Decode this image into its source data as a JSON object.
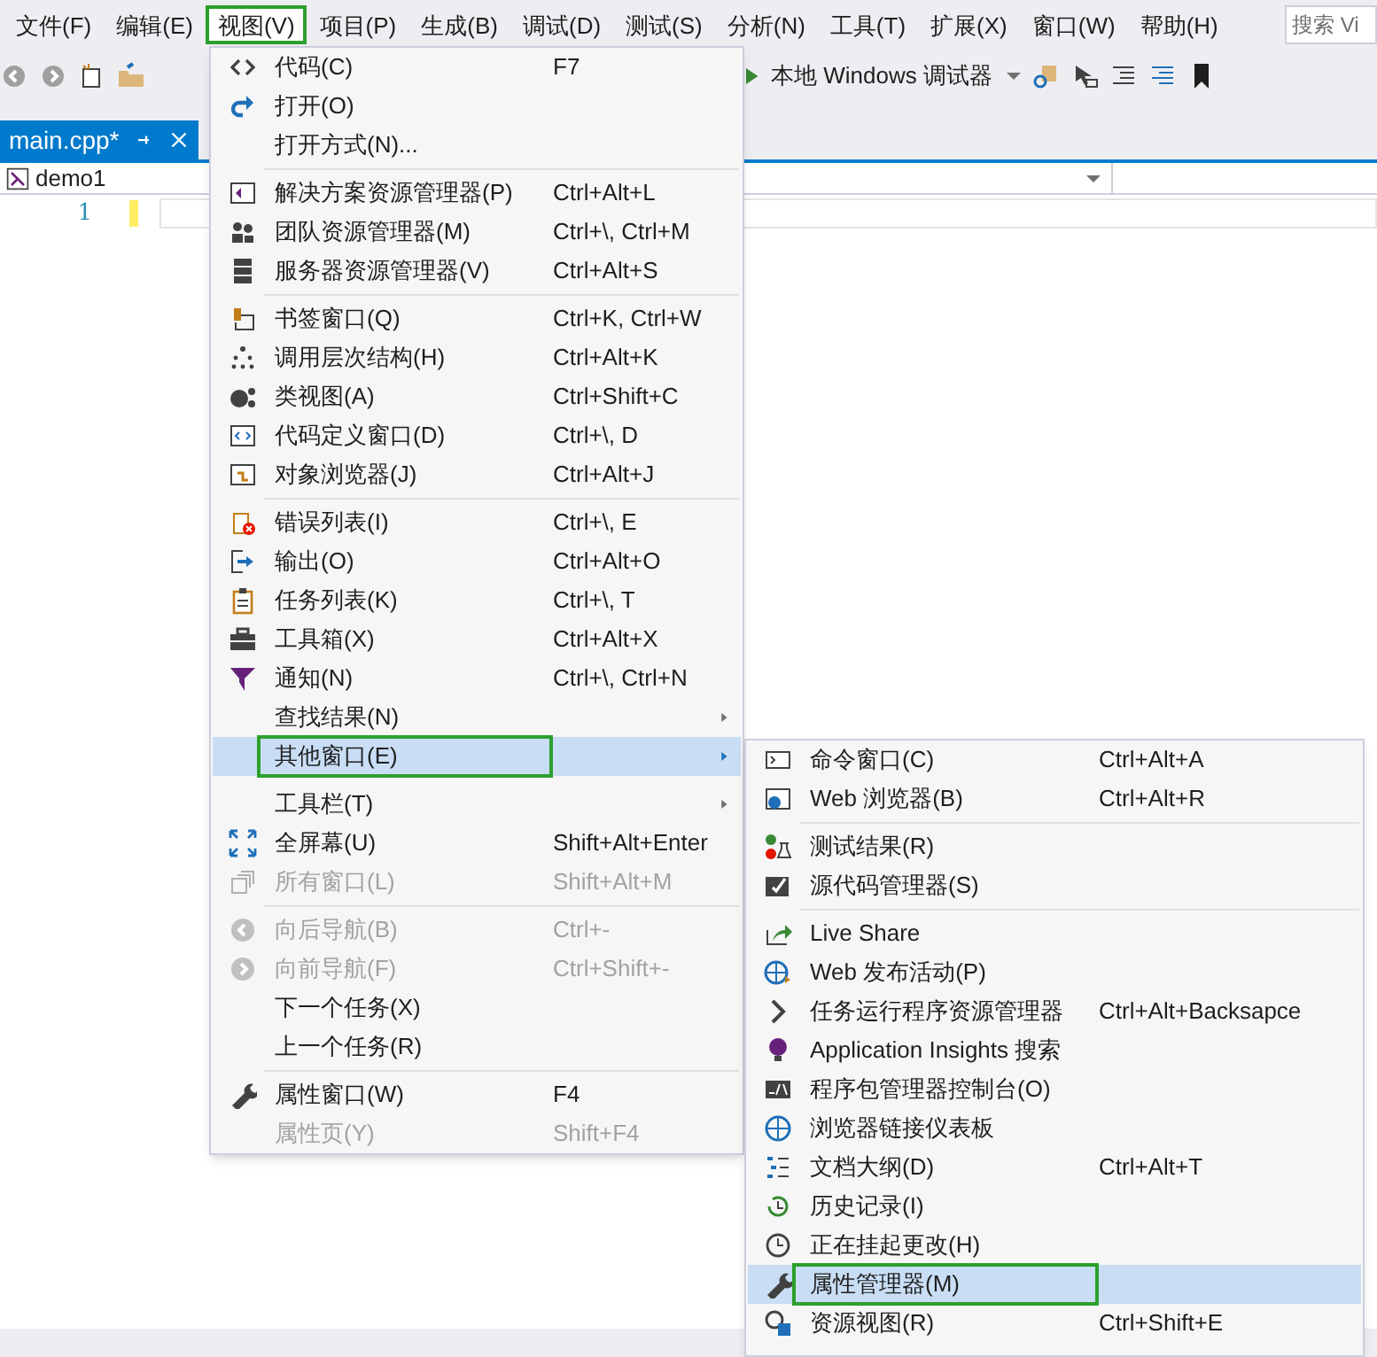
{
  "menubar": {
    "items": [
      {
        "label": "文件(F)",
        "outlined": false
      },
      {
        "label": "编辑(E)",
        "outlined": false
      },
      {
        "label": "视图(V)",
        "outlined": true
      },
      {
        "label": "项目(P)",
        "outlined": false
      },
      {
        "label": "生成(B)",
        "outlined": false
      },
      {
        "label": "调试(D)",
        "outlined": false
      },
      {
        "label": "测试(S)",
        "outlined": false
      },
      {
        "label": "分析(N)",
        "outlined": false
      },
      {
        "label": "工具(T)",
        "outlined": false
      },
      {
        "label": "扩展(X)",
        "outlined": false
      },
      {
        "label": "窗口(W)",
        "outlined": false
      },
      {
        "label": "帮助(H)",
        "outlined": false
      }
    ],
    "search": {
      "placeholder": "搜索 Vi"
    }
  },
  "toolbar": {
    "debug_button": "本地 Windows 调试器"
  },
  "tab": {
    "label": "main.cpp*",
    "selected": true
  },
  "nav_bar": {
    "scope": "demo1"
  },
  "editor": {
    "line_numbers": [
      "1"
    ]
  },
  "view_menu": [
    {
      "kind": "item",
      "label": "代码(C)",
      "shortcut": "F7",
      "disabled": false,
      "selected": false,
      "outlined": false,
      "submenu": false
    },
    {
      "kind": "item",
      "label": "打开(O)",
      "disabled": false,
      "selected": false,
      "outlined": false,
      "submenu": false
    },
    {
      "kind": "item",
      "label": "打开方式(N)...",
      "disabled": false,
      "selected": false,
      "outlined": false,
      "submenu": false
    },
    {
      "kind": "separator"
    },
    {
      "kind": "item",
      "label": "解决方案资源管理器(P)",
      "shortcut": "Ctrl+Alt+L",
      "disabled": false,
      "selected": false,
      "outlined": false,
      "submenu": false
    },
    {
      "kind": "item",
      "label": "团队资源管理器(M)",
      "shortcut": "Ctrl+\\, Ctrl+M",
      "disabled": false,
      "selected": false,
      "outlined": false,
      "submenu": false
    },
    {
      "kind": "item",
      "label": "服务器资源管理器(V)",
      "shortcut": "Ctrl+Alt+S",
      "disabled": false,
      "selected": false,
      "outlined": false,
      "submenu": false
    },
    {
      "kind": "separator"
    },
    {
      "kind": "item",
      "label": "书签窗口(Q)",
      "shortcut": "Ctrl+K, Ctrl+W",
      "disabled": false,
      "selected": false,
      "outlined": false,
      "submenu": false
    },
    {
      "kind": "item",
      "label": "调用层次结构(H)",
      "shortcut": "Ctrl+Alt+K",
      "disabled": false,
      "selected": false,
      "outlined": false,
      "submenu": false
    },
    {
      "kind": "item",
      "label": "类视图(A)",
      "shortcut": "Ctrl+Shift+C",
      "disabled": false,
      "selected": false,
      "outlined": false,
      "submenu": false
    },
    {
      "kind": "item",
      "label": "代码定义窗口(D)",
      "shortcut": "Ctrl+\\, D",
      "disabled": false,
      "selected": false,
      "outlined": false,
      "submenu": false
    },
    {
      "kind": "item",
      "label": "对象浏览器(J)",
      "shortcut": "Ctrl+Alt+J",
      "disabled": false,
      "selected": false,
      "outlined": false,
      "submenu": false
    },
    {
      "kind": "separator"
    },
    {
      "kind": "item",
      "label": "错误列表(I)",
      "shortcut": "Ctrl+\\, E",
      "disabled": false,
      "selected": false,
      "outlined": false,
      "submenu": false
    },
    {
      "kind": "item",
      "label": "输出(O)",
      "shortcut": "Ctrl+Alt+O",
      "disabled": false,
      "selected": false,
      "outlined": false,
      "submenu": false
    },
    {
      "kind": "item",
      "label": "任务列表(K)",
      "shortcut": "Ctrl+\\, T",
      "disabled": false,
      "selected": false,
      "outlined": false,
      "submenu": false
    },
    {
      "kind": "item",
      "label": "工具箱(X)",
      "shortcut": "Ctrl+Alt+X",
      "disabled": false,
      "selected": false,
      "outlined": false,
      "submenu": false
    },
    {
      "kind": "item",
      "label": "通知(N)",
      "shortcut": "Ctrl+\\, Ctrl+N",
      "disabled": false,
      "selected": false,
      "outlined": false,
      "submenu": false
    },
    {
      "kind": "item",
      "label": "查找结果(N)",
      "disabled": false,
      "selected": false,
      "outlined": false,
      "submenu": true
    },
    {
      "kind": "item",
      "label": "其他窗口(E)",
      "disabled": false,
      "selected": true,
      "outlined": true,
      "submenu": true
    },
    {
      "kind": "spacer"
    },
    {
      "kind": "item",
      "label": "工具栏(T)",
      "disabled": false,
      "selected": false,
      "outlined": false,
      "submenu": true
    },
    {
      "kind": "item",
      "label": "全屏幕(U)",
      "shortcut": "Shift+Alt+Enter",
      "disabled": false,
      "selected": false,
      "outlined": false,
      "submenu": false
    },
    {
      "kind": "item",
      "label": "所有窗口(L)",
      "shortcut": "Shift+Alt+M",
      "disabled": true,
      "selected": false,
      "outlined": false,
      "submenu": false
    },
    {
      "kind": "separator"
    },
    {
      "kind": "item",
      "label": "向后导航(B)",
      "shortcut": "Ctrl+-",
      "disabled": true,
      "selected": false,
      "outlined": false,
      "submenu": false
    },
    {
      "kind": "item",
      "label": "向前导航(F)",
      "shortcut": "Ctrl+Shift+-",
      "disabled": true,
      "selected": false,
      "outlined": false,
      "submenu": false
    },
    {
      "kind": "item",
      "label": "下一个任务(X)",
      "disabled": false,
      "selected": false,
      "outlined": false,
      "submenu": false
    },
    {
      "kind": "item",
      "label": "上一个任务(R)",
      "disabled": false,
      "selected": false,
      "outlined": false,
      "submenu": false
    },
    {
      "kind": "separator"
    },
    {
      "kind": "item",
      "label": "属性窗口(W)",
      "shortcut": "F4",
      "disabled": false,
      "selected": false,
      "outlined": false,
      "submenu": false
    },
    {
      "kind": "item",
      "label": "属性页(Y)",
      "shortcut": "Shift+F4",
      "disabled": true,
      "selected": false,
      "outlined": false,
      "submenu": false
    }
  ],
  "other_windows_menu": [
    {
      "kind": "item",
      "label": "命令窗口(C)",
      "shortcut": "Ctrl+Alt+A",
      "selected": false,
      "outlined": false
    },
    {
      "kind": "item",
      "label": "Web 浏览器(B)",
      "shortcut": "Ctrl+Alt+R",
      "selected": false,
      "outlined": false
    },
    {
      "kind": "separator"
    },
    {
      "kind": "item",
      "label": "测试结果(R)",
      "selected": false,
      "outlined": false
    },
    {
      "kind": "item",
      "label": "源代码管理器(S)",
      "selected": false,
      "outlined": false
    },
    {
      "kind": "separator"
    },
    {
      "kind": "item",
      "label": "Live Share",
      "selected": false,
      "outlined": false
    },
    {
      "kind": "item",
      "label": "Web 发布活动(P)",
      "selected": false,
      "outlined": false
    },
    {
      "kind": "item",
      "label": "任务运行程序资源管理器",
      "shortcut": "Ctrl+Alt+Backsapce",
      "selected": false,
      "outlined": false
    },
    {
      "kind": "item",
      "label": "Application Insights 搜索",
      "selected": false,
      "outlined": false
    },
    {
      "kind": "item",
      "label": "程序包管理器控制台(O)",
      "selected": false,
      "outlined": false
    },
    {
      "kind": "item",
      "label": "浏览器链接仪表板",
      "selected": false,
      "outlined": false
    },
    {
      "kind": "item",
      "label": "文档大纲(D)",
      "shortcut": "Ctrl+Alt+T",
      "selected": false,
      "outlined": false
    },
    {
      "kind": "item",
      "label": "历史记录(I)",
      "selected": false,
      "outlined": false
    },
    {
      "kind": "item",
      "label": "正在挂起更改(H)",
      "selected": false,
      "outlined": false
    },
    {
      "kind": "item",
      "label": "属性管理器(M)",
      "selected": true,
      "outlined": true
    },
    {
      "kind": "item",
      "label": "资源视图(R)",
      "shortcut": "Ctrl+Shift+E",
      "selected": false,
      "outlined": false
    }
  ]
}
